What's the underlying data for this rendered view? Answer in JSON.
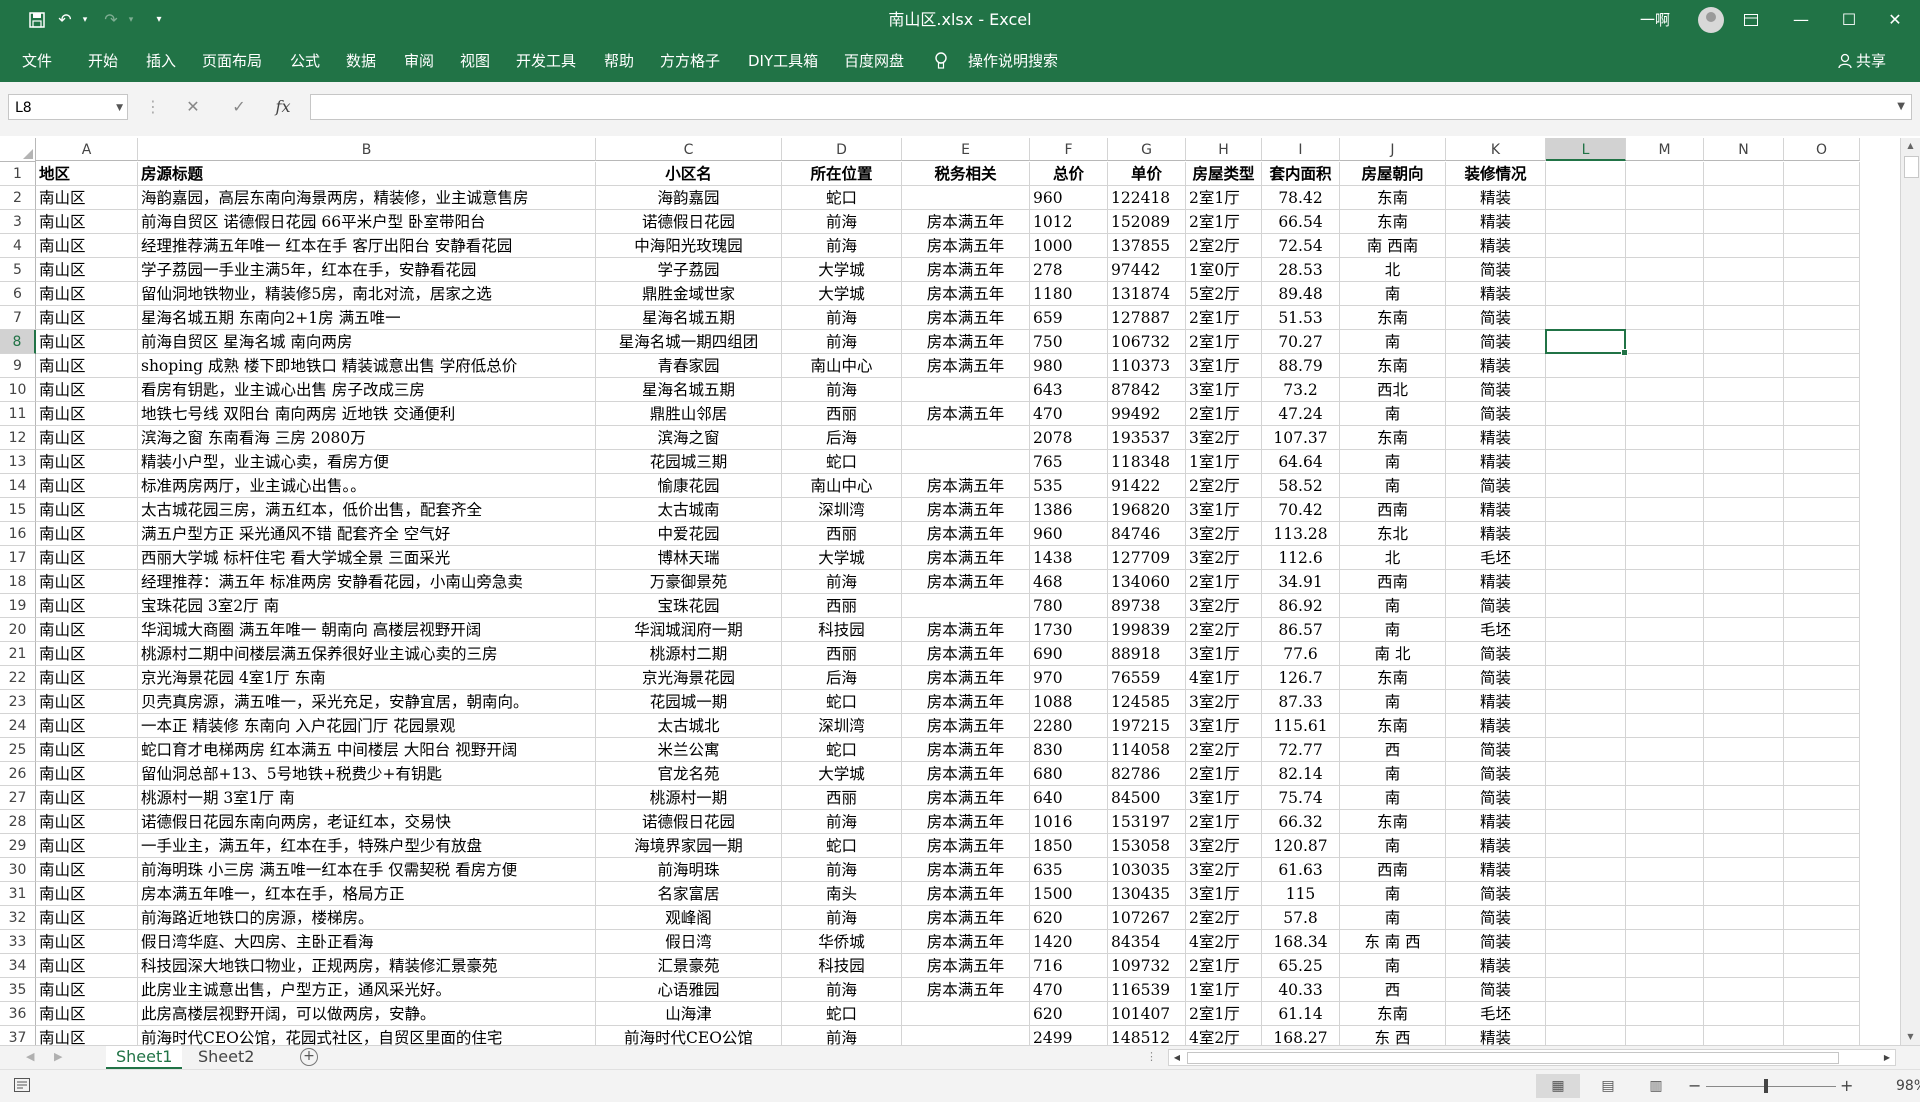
{
  "app": {
    "title": "南山区.xlsx  -  Excel",
    "user": "一啊",
    "qat": [
      "save-icon",
      "undo-icon",
      "redo-icon",
      "customize-icon"
    ],
    "window_controls": [
      "ribbon-display-icon",
      "minimize-icon",
      "maximize-icon",
      "close-icon"
    ]
  },
  "ribbon": {
    "tabs": [
      "文件",
      "开始",
      "插入",
      "页面布局",
      "公式",
      "数据",
      "审阅",
      "视图",
      "开发工具",
      "帮助",
      "方方格子",
      "DIY工具箱",
      "百度网盘"
    ],
    "tell_me": "操作说明搜索",
    "share": "共享"
  },
  "formula_bar": {
    "name_box": "L8",
    "cancel": "✕",
    "enter": "✓",
    "fx": "fx",
    "formula": ""
  },
  "sheet": {
    "columns": [
      "A",
      "B",
      "C",
      "D",
      "E",
      "F",
      "G",
      "H",
      "I",
      "J",
      "K",
      "L",
      "M",
      "N",
      "O"
    ],
    "selected_column": "L",
    "selected_row": 8,
    "row_numbers": [
      1,
      2,
      3,
      4,
      5,
      6,
      7,
      8,
      9,
      10,
      11,
      12,
      13,
      14,
      15,
      16,
      17,
      18,
      19,
      20,
      21,
      22,
      23,
      24,
      25,
      26,
      27,
      28,
      29,
      30,
      31,
      32,
      33,
      34,
      35,
      36,
      37
    ],
    "headers": [
      "地区",
      "房源标题",
      "小区名",
      "所在位置",
      "税务相关",
      "总价",
      "单价",
      "房屋类型",
      "套内面积",
      "房屋朝向",
      "装修情况"
    ],
    "rows": [
      [
        "南山区",
        "海韵嘉园，高层东南向海景两房，精装修，业主诚意售房",
        "海韵嘉园",
        "蛇口",
        "",
        "960",
        "122418",
        "2室1厅",
        "78.42",
        "东南",
        "精装"
      ],
      [
        "南山区",
        "前海自贸区 诺德假日花园 66平米户型 卧室带阳台",
        "诺德假日花园",
        "前海",
        "房本满五年",
        "1012",
        "152089",
        "2室1厅",
        "66.54",
        "东南",
        "精装"
      ],
      [
        "南山区",
        "经理推荐满五年唯一 红本在手 客厅出阳台 安静看花园",
        "中海阳光玫瑰园",
        "前海",
        "房本满五年",
        "1000",
        "137855",
        "2室2厅",
        "72.54",
        "南 西南",
        "精装"
      ],
      [
        "南山区",
        "学子荔园一手业主满5年，红本在手，安静看花园",
        "学子荔园",
        "大学城",
        "房本满五年",
        "278",
        "97442",
        "1室0厅",
        "28.53",
        "北",
        "简装"
      ],
      [
        "南山区",
        "留仙洞地铁物业，精装修5房，南北对流，居家之选",
        "鼎胜金域世家",
        "大学城",
        "房本满五年",
        "1180",
        "131874",
        "5室2厅",
        "89.48",
        "南",
        "精装"
      ],
      [
        "南山区",
        "星海名城五期 东南向2+1房 满五唯一",
        "星海名城五期",
        "前海",
        "房本满五年",
        "659",
        "127887",
        "2室1厅",
        "51.53",
        "东南",
        "简装"
      ],
      [
        "南山区",
        "前海自贸区  星海名城  南向两房",
        "星海名城一期四组团",
        "前海",
        "房本满五年",
        "750",
        "106732",
        "2室1厅",
        "70.27",
        "南",
        "简装"
      ],
      [
        "南山区",
        "shoping 成熟 楼下即地铁口 精装诚意出售 学府低总价",
        "青春家园",
        "南山中心",
        "房本满五年",
        "980",
        "110373",
        "3室1厅",
        "88.79",
        "东南",
        "精装"
      ],
      [
        "南山区",
        "看房有钥匙，业主诚心出售  房子改成三房",
        "星海名城五期",
        "前海",
        "",
        "643",
        "87842",
        "3室1厅",
        "73.2",
        "西北",
        "简装"
      ],
      [
        "南山区",
        "地铁七号线 双阳台 南向两房 近地铁 交通便利",
        "鼎胜山邻居",
        "西丽",
        "房本满五年",
        "470",
        "99492",
        "2室1厅",
        "47.24",
        "南",
        "简装"
      ],
      [
        "南山区",
        "滨海之窗  东南看海     三房 2080万",
        "滨海之窗",
        "后海",
        "",
        "2078",
        "193537",
        "3室2厅",
        "107.37",
        "东南",
        "精装"
      ],
      [
        "南山区",
        "精装小户型，业主诚心卖，看房方便",
        "花园城三期",
        "蛇口",
        "",
        "765",
        "118348",
        "1室1厅",
        "64.64",
        "南",
        "精装"
      ],
      [
        "南山区",
        "标准两房两厅，业主诚心出售。。",
        "愉康花园",
        "南山中心",
        "房本满五年",
        "535",
        "91422",
        "2室2厅",
        "58.52",
        "南",
        "简装"
      ],
      [
        "南山区",
        "太古城花园三房，满五红本，低价出售，配套齐全",
        "太古城南",
        "深圳湾",
        "房本满五年",
        "1386",
        "196820",
        "3室1厅",
        "70.42",
        "西南",
        "精装"
      ],
      [
        "南山区",
        "满五户型方正 采光通风不错 配套齐全 空气好",
        "中爱花园",
        "西丽",
        "房本满五年",
        "960",
        "84746",
        "3室2厅",
        "113.28",
        "东北",
        "精装"
      ],
      [
        "南山区",
        "西丽大学城 标杆住宅 看大学城全景 三面采光",
        "博林天瑞",
        "大学城",
        "房本满五年",
        "1438",
        "127709",
        "3室2厅",
        "112.6",
        "北",
        "毛坯"
      ],
      [
        "南山区",
        "经理推荐：满五年 标准两房 安静看花园，小南山旁急卖",
        "万豪御景苑",
        "前海",
        "房本满五年",
        "468",
        "134060",
        "2室1厅",
        "34.91",
        "西南",
        "精装"
      ],
      [
        "南山区",
        "宝珠花园 3室2厅 南",
        "宝珠花园",
        "西丽",
        "",
        "780",
        "89738",
        "3室2厅",
        "86.92",
        "南",
        "简装"
      ],
      [
        "南山区",
        "华润城大商圈 满五年唯一 朝南向 高楼层视野开阔",
        "华润城润府一期",
        "科技园",
        "房本满五年",
        "1730",
        "199839",
        "2室2厅",
        "86.57",
        "南",
        "毛坯"
      ],
      [
        "南山区",
        "桃源村二期中间楼层满五保养很好业主诚心卖的三房",
        "桃源村二期",
        "西丽",
        "房本满五年",
        "690",
        "88918",
        "3室1厅",
        "77.6",
        "南 北",
        "简装"
      ],
      [
        "南山区",
        "京光海景花园 4室1厅 东南",
        "京光海景花园",
        "后海",
        "房本满五年",
        "970",
        "76559",
        "4室1厅",
        "126.7",
        "东南",
        "简装"
      ],
      [
        "南山区",
        "贝壳真房源，满五唯一，采光充足，安静宜居，朝南向。",
        "花园城一期",
        "蛇口",
        "房本满五年",
        "1088",
        "124585",
        "3室2厅",
        "87.33",
        "南",
        "精装"
      ],
      [
        "南山区",
        "一本正 精装修 东南向 入户花园门厅 花园景观",
        "太古城北",
        "深圳湾",
        "房本满五年",
        "2280",
        "197215",
        "3室1厅",
        "115.61",
        "东南",
        "精装"
      ],
      [
        "南山区",
        "蛇口育才电梯两房 红本满五 中间楼层 大阳台 视野开阔",
        "米兰公寓",
        "蛇口",
        "房本满五年",
        "830",
        "114058",
        "2室2厅",
        "72.77",
        "西",
        "简装"
      ],
      [
        "南山区",
        "留仙洞总部+13、5号地铁+税费少+有钥匙",
        "官龙名苑",
        "大学城",
        "房本满五年",
        "680",
        "82786",
        "2室1厅",
        "82.14",
        "南",
        "简装"
      ],
      [
        "南山区",
        "桃源村一期 3室1厅 南",
        "桃源村一期",
        "西丽",
        "房本满五年",
        "640",
        "84500",
        "3室1厅",
        "75.74",
        "南",
        "简装"
      ],
      [
        "南山区",
        "诺德假日花园东南向两房，老证红本，交易快",
        "诺德假日花园",
        "前海",
        "房本满五年",
        "1016",
        "153197",
        "2室1厅",
        "66.32",
        "东南",
        "精装"
      ],
      [
        "南山区",
        "一手业主，满五年，红本在手，特殊户型少有放盘",
        "海境界家园一期",
        "蛇口",
        "房本满五年",
        "1850",
        "153058",
        "3室2厅",
        "120.87",
        "南",
        "精装"
      ],
      [
        "南山区",
        "前海明珠 小三房 满五唯一红本在手 仅需契税 看房方便",
        "前海明珠",
        "前海",
        "房本满五年",
        "635",
        "103035",
        "3室2厅",
        "61.63",
        "西南",
        "精装"
      ],
      [
        "南山区",
        "房本满五年唯一，红本在手，格局方正",
        "名家富居",
        "南头",
        "房本满五年",
        "1500",
        "130435",
        "3室1厅",
        "115",
        "南",
        "简装"
      ],
      [
        "南山区",
        "前海路近地铁口的房源，楼梯房。",
        "观峰阁",
        "前海",
        "房本满五年",
        "620",
        "107267",
        "2室2厅",
        "57.8",
        "南",
        "简装"
      ],
      [
        "南山区",
        "假日湾华庭、大四房、主卧正看海",
        "假日湾",
        "华侨城",
        "房本满五年",
        "1420",
        "84354",
        "4室2厅",
        "168.34",
        "东 南 西",
        "简装"
      ],
      [
        "南山区",
        "科技园深大地铁口物业，正规两房，精装修汇景豪苑",
        "汇景豪苑",
        "科技园",
        "房本满五年",
        "716",
        "109732",
        "2室1厅",
        "65.25",
        "南",
        "精装"
      ],
      [
        "南山区",
        "此房业主诚意出售，户型方正，通风采光好。",
        "心语雅园",
        "前海",
        "房本满五年",
        "470",
        "116539",
        "1室1厅",
        "40.33",
        "西",
        "简装"
      ],
      [
        "南山区",
        "此房高楼层视野开阔，可以做两房，安静。",
        "山海津",
        "蛇口",
        "",
        "620",
        "101407",
        "2室1厅",
        "61.14",
        "东南",
        "毛坯"
      ],
      [
        "南山区",
        "前海时代CEO公馆，花园式社区，自贸区里面的住宅",
        "前海时代CEO公馆",
        "前海",
        "",
        "2499",
        "148512",
        "4室2厅",
        "168.27",
        "东 西",
        "精装"
      ]
    ]
  },
  "sheet_tabs": {
    "tabs": [
      "Sheet1",
      "Sheet2"
    ],
    "active": "Sheet1",
    "add": "+"
  },
  "status": {
    "zoom": "98%",
    "views": [
      "normal-view-icon",
      "page-layout-view-icon",
      "page-break-view-icon"
    ],
    "zoom_minus": "−",
    "zoom_plus": "+"
  }
}
